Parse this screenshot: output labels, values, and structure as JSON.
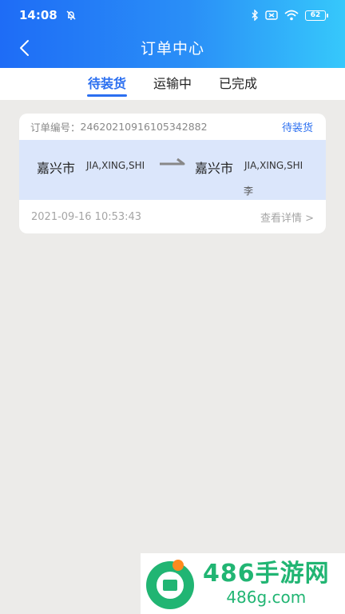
{
  "status_bar": {
    "time": "14:08",
    "battery": "62"
  },
  "nav": {
    "title": "订单中心"
  },
  "tabs": [
    {
      "label": "待装货"
    },
    {
      "label": "运输中"
    },
    {
      "label": "已完成"
    }
  ],
  "order": {
    "number_label": "订单编号：",
    "number": "2462021091610534288",
    "number_suffix": "2",
    "status": "待装货",
    "origin_city": "嘉兴市",
    "origin_pinyin": "JIA,XING,SHI",
    "dest_city": "嘉兴市",
    "dest_pinyin": "JIA,XING,SHI",
    "person": "李",
    "datetime": "2021-09-16 10:53:43",
    "detail_label": "查看详情 >"
  },
  "watermark": {
    "title": "486手游网",
    "url": "486g.com"
  },
  "colors": {
    "accent": "#2b6ff0",
    "header_start": "#1e6cf6",
    "header_end": "#36c8fb",
    "route_bg": "#dbe6fb",
    "watermark_green": "#21b573"
  }
}
